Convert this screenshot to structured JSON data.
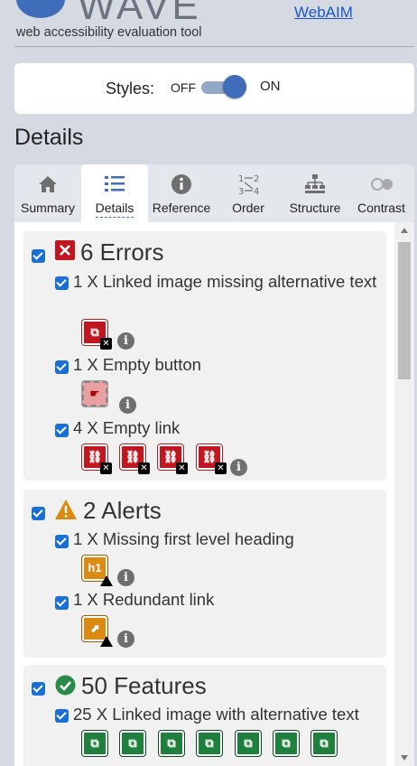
{
  "header": {
    "logo_text": "WAVE",
    "tagline": "web accessibility evaluation tool",
    "webaim_link": "WebAIM"
  },
  "styles": {
    "label": "Styles:",
    "off": "OFF",
    "on": "ON",
    "state": "on"
  },
  "details_title": "Details",
  "tabs": [
    {
      "label": "Summary",
      "icon": "home-icon"
    },
    {
      "label": "Details",
      "icon": "list-icon",
      "active": true
    },
    {
      "label": "Reference",
      "icon": "info-icon"
    },
    {
      "label": "Order",
      "icon": "order-icon"
    },
    {
      "label": "Structure",
      "icon": "structure-icon"
    },
    {
      "label": "Contrast",
      "icon": "contrast-icon"
    }
  ],
  "errors": {
    "title": "6 Errors",
    "items": [
      {
        "text": "1 X Linked image missing alternative text",
        "count": 1
      },
      {
        "text": "1 X Empty button",
        "count": 1
      },
      {
        "text": "4 X Empty link",
        "count": 4
      }
    ]
  },
  "alerts": {
    "title": "2 Alerts",
    "items": [
      {
        "text": "1 X Missing first level heading",
        "badge": "h1"
      },
      {
        "text": "1 X Redundant link"
      }
    ]
  },
  "features": {
    "title": "50 Features",
    "items": [
      {
        "text": "25 X Linked image with alternative text",
        "visible_badges": 7
      }
    ]
  },
  "colors": {
    "accent": "#3f6dba",
    "error": "#c0161f",
    "alert": "#dc8a12",
    "feature": "#1f7f3c"
  }
}
